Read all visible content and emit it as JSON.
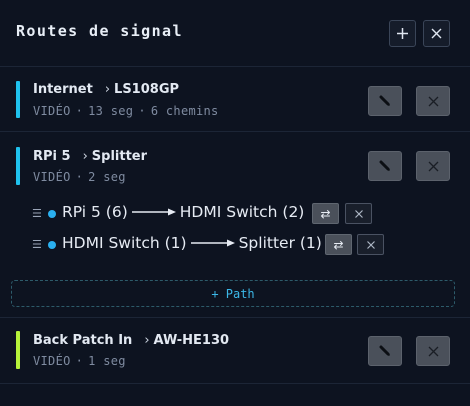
{
  "header": {
    "title": "Routes de signal",
    "add_icon": "plus-icon",
    "close_icon": "close-icon"
  },
  "colors": {
    "background": "#0d1320",
    "accent_cyan": "#1fc2ee",
    "accent_green": "#b6f23a",
    "segment_dot": "#2ab0f0",
    "add_path_text": "#3cb8e8"
  },
  "routes": [
    {
      "source": "Internet",
      "dest": "LS108GP",
      "type": "VIDÉO",
      "segments": "13 seg",
      "paths": "6 chemins",
      "accent": "cyan"
    },
    {
      "source": "RPi 5",
      "dest": "Splitter",
      "type": "VIDÉO",
      "segments": "2 seg",
      "accent": "cyan",
      "expanded": true,
      "hops": [
        {
          "from": "RPi 5 (6)",
          "to": "HDMI Switch (2)"
        },
        {
          "from": "HDMI Switch (1)",
          "to": "Splitter (1)"
        }
      ],
      "add_path_label": "+ Path"
    },
    {
      "source": "Back Patch In",
      "dest": "AW-HE130",
      "type": "VIDÉO",
      "segments": "1 seg",
      "accent": "green"
    }
  ],
  "icons": {
    "route_arrow": "›",
    "meta_separator": "·",
    "drag_handle": "☰",
    "swap": "⇄",
    "edit": "pencil-icon",
    "delete": "x-icon"
  }
}
